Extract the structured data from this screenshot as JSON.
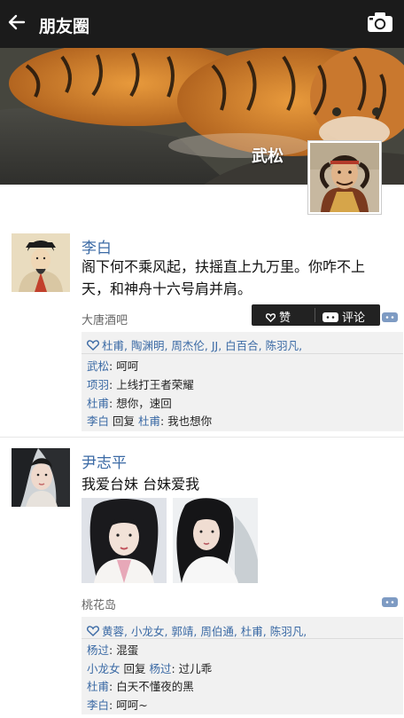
{
  "header": {
    "title": "朋友圈",
    "back_icon": "back-arrow-icon",
    "camera_icon": "camera-icon"
  },
  "cover": {
    "user_name": "武松"
  },
  "posts": [
    {
      "author": "李白",
      "text": "阁下何不乘风起，扶摇直上九万里。你咋不上天，和神舟十六号肩并肩。",
      "location": "大唐酒吧",
      "actions": {
        "like_label": "赞",
        "comment_label": "评论"
      },
      "likes": "杜甫, 陶渊明, 周杰伦, JJ, 白百合, 陈羽凡,",
      "comments": [
        {
          "user": "武松",
          "sep": ": ",
          "text": "呵呵"
        },
        {
          "user": "项羽",
          "sep": ": ",
          "text": "上线打王者荣耀"
        },
        {
          "user": "杜甫",
          "sep": ": ",
          "text": "想你，速回"
        },
        {
          "user": "李白",
          "reply_word": " 回复 ",
          "reply_to": "杜甫",
          "sep": ": ",
          "text": "我也想你"
        }
      ]
    },
    {
      "author": "尹志平",
      "text": "我爱台妹 台妹爱我",
      "location": "桃花岛",
      "likes": "黄蓉, 小龙女, 郭靖, 周伯通, 杜甫, 陈羽凡,",
      "comments": [
        {
          "user": "杨过",
          "sep": ": ",
          "text": "混蛋"
        },
        {
          "user": "小龙女",
          "reply_word": " 回复 ",
          "reply_to": "杨过",
          "sep": ": ",
          "text": "过儿乖"
        },
        {
          "user": "杜甫",
          "sep": ": ",
          "text": "白天不懂夜的黑"
        },
        {
          "user": "李白",
          "sep": ": ",
          "text": "呵呵~"
        }
      ]
    }
  ],
  "colors": {
    "topbar": "#1b1b1b",
    "name_link": "#3b6aa5",
    "feedback_bg": "#f1f1f1"
  }
}
